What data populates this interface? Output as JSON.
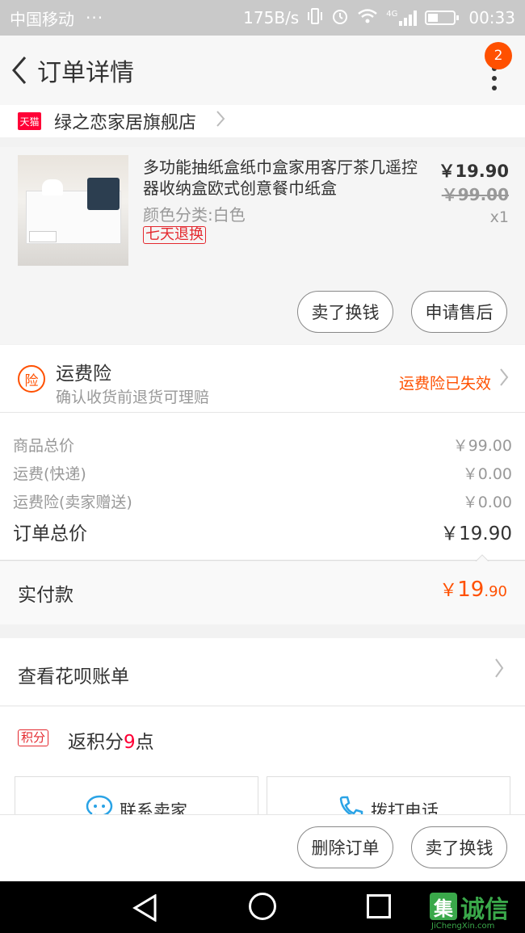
{
  "status_bar": {
    "carrier": "中国移动",
    "dots": "···",
    "speed": "175B/s",
    "network": "4G",
    "time": "00:33"
  },
  "nav": {
    "title": "订单详情",
    "badge": "2"
  },
  "shop": {
    "tag": "天猫",
    "name": "绿之恋家居旗舰店"
  },
  "item": {
    "title": "多功能抽纸盒纸巾盒家用客厅茶几遥控器收纳盒欧式创意餐巾纸盒",
    "sku": "颜色分类:白色",
    "return_tag": "七天退换",
    "price": "￥19.90",
    "original_price": "￥99.00",
    "quantity": "x1",
    "buttons": [
      "卖了换钱",
      "申请售后"
    ]
  },
  "insurance": {
    "icon_text": "险",
    "title": "运费险",
    "subtitle": "确认收货前退货可理赔",
    "status": "运费险已失效"
  },
  "summary": {
    "rows": [
      {
        "label": "商品总价",
        "value": "￥99.00"
      },
      {
        "label": "运费(快递)",
        "value": "￥0.00"
      },
      {
        "label": "运费险(卖家赠送)",
        "value": "￥0.00"
      }
    ],
    "total_label": "订单总价",
    "total_value": "￥19.90"
  },
  "payment": {
    "label": "实付款",
    "currency": "￥",
    "integer": "19",
    "decimal": ".90"
  },
  "huabei": {
    "label": "查看花呗账单"
  },
  "points": {
    "tag": "积分",
    "prefix": "返积分",
    "number": "9",
    "suffix": "点"
  },
  "contact": {
    "seller": "联系卖家",
    "phone": "拨打电话"
  },
  "bottom_actions": [
    "删除订单",
    "卖了换钱"
  ],
  "watermark": {
    "logo": "集",
    "text": "诚信",
    "sub": "JiChengXin.com"
  },
  "colors": {
    "accent": "#ff5000",
    "tmall_red": "#ff0036",
    "tag_red": "#e4292f"
  }
}
